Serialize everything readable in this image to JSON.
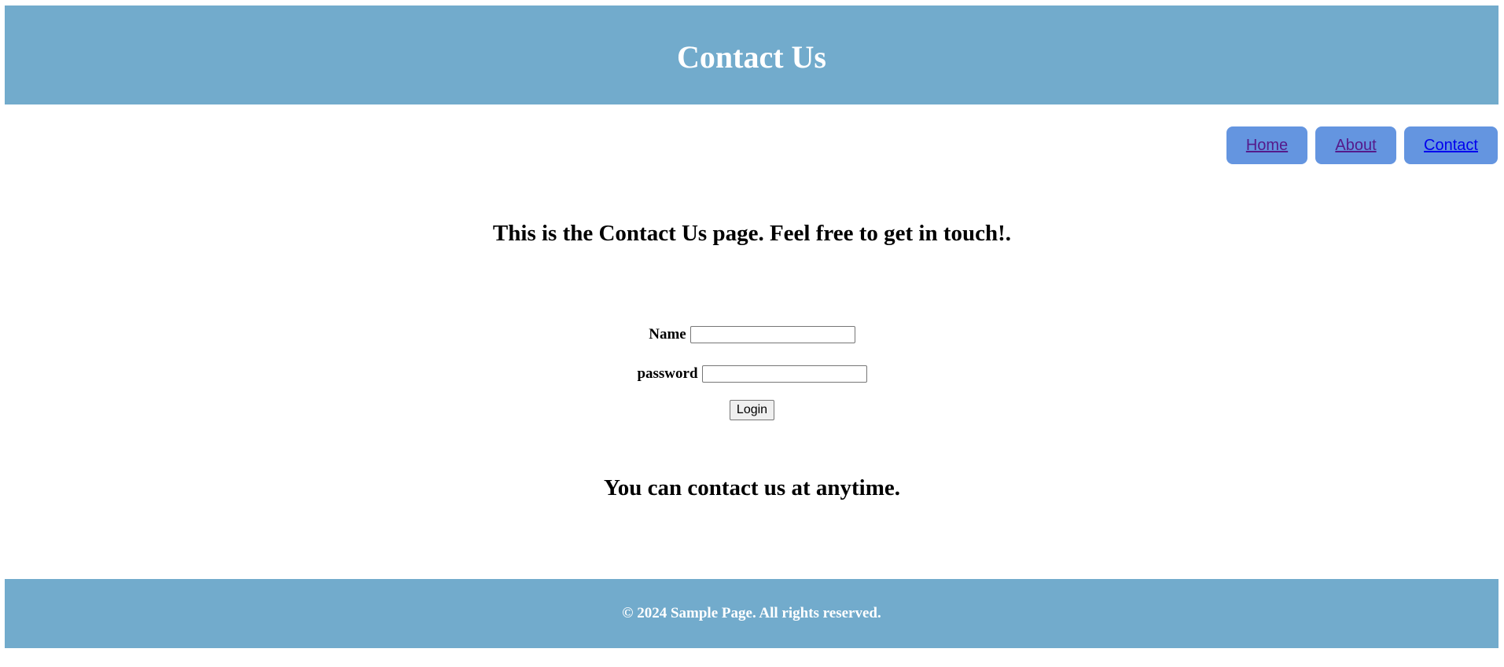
{
  "header": {
    "title": "Contact Us"
  },
  "nav": {
    "items": [
      {
        "label": "Home",
        "state": "visited"
      },
      {
        "label": "About",
        "state": "visited"
      },
      {
        "label": "Contact",
        "state": "link"
      }
    ]
  },
  "main": {
    "intro": "This is the Contact Us page. Feel free to get in touch!.",
    "form": {
      "name_label": "Name",
      "name_value": "",
      "password_label": "password",
      "password_value": "",
      "login_label": "Login"
    },
    "outro": "You can contact us at anytime."
  },
  "footer": {
    "text": "© 2024 Sample Page. All rights reserved."
  },
  "colors": {
    "header_bg": "#72abcc",
    "footer_bg": "#72abcc",
    "nav_button_bg": "#6495e0",
    "visited_link": "#551a8b",
    "link": "#0000ee"
  }
}
